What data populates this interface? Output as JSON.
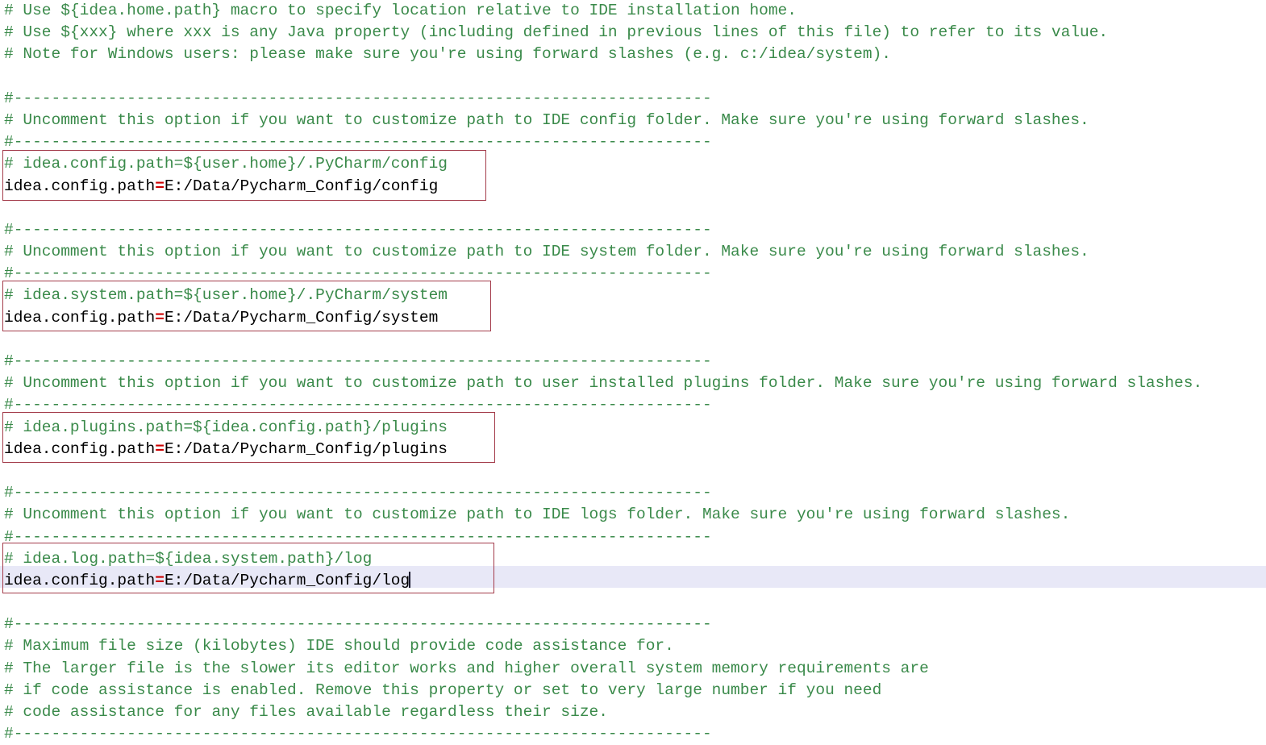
{
  "editor": {
    "kind": "properties-file-editor",
    "colors": {
      "background": "#ffffff",
      "comment": "#3a8a4a",
      "text": "#000000",
      "separator_red": "#cc0000",
      "box_border": "#a33b4a",
      "current_line": "#e8e8f7"
    },
    "separator_line": "#--------------------------------------------------------------------------",
    "caret_symbol": "text-caret"
  },
  "lines": [
    {
      "type": "comment",
      "text": "# Use ${idea.home.path} macro to specify location relative to IDE installation home."
    },
    {
      "type": "comment",
      "text": "# Use ${xxx} where xxx is any Java property (including defined in previous lines of this file) to refer to its value."
    },
    {
      "type": "comment",
      "text": "# Note for Windows users: please make sure you're using forward slashes (e.g. c:/idea/system)."
    },
    {
      "type": "blank",
      "text": ""
    },
    {
      "type": "comment",
      "text": "#--------------------------------------------------------------------------"
    },
    {
      "type": "comment",
      "text": "# Uncomment this option if you want to customize path to IDE config folder. Make sure you're using forward slashes."
    },
    {
      "type": "comment",
      "text": "#--------------------------------------------------------------------------"
    },
    {
      "type": "comment",
      "text": "# idea.config.path=${user.home}/.PyCharm/config"
    },
    {
      "type": "property",
      "key": "idea.config.path",
      "eq": "=",
      "value": "E:/Data/Pycharm_Config/config"
    },
    {
      "type": "blank",
      "text": ""
    },
    {
      "type": "comment",
      "text": "#--------------------------------------------------------------------------"
    },
    {
      "type": "comment",
      "text": "# Uncomment this option if you want to customize path to IDE system folder. Make sure you're using forward slashes."
    },
    {
      "type": "comment",
      "text": "#--------------------------------------------------------------------------"
    },
    {
      "type": "comment",
      "text": "# idea.system.path=${user.home}/.PyCharm/system"
    },
    {
      "type": "property",
      "key": "idea.config.path",
      "eq": "=",
      "value": "E:/Data/Pycharm_Config/system"
    },
    {
      "type": "blank",
      "text": ""
    },
    {
      "type": "comment",
      "text": "#--------------------------------------------------------------------------"
    },
    {
      "type": "comment",
      "text": "# Uncomment this option if you want to customize path to user installed plugins folder. Make sure you're using forward slashes."
    },
    {
      "type": "comment",
      "text": "#--------------------------------------------------------------------------"
    },
    {
      "type": "comment",
      "text": "# idea.plugins.path=${idea.config.path}/plugins"
    },
    {
      "type": "property",
      "key": "idea.config.path",
      "eq": "=",
      "value": "E:/Data/Pycharm_Config/plugins"
    },
    {
      "type": "blank",
      "text": ""
    },
    {
      "type": "comment",
      "text": "#--------------------------------------------------------------------------"
    },
    {
      "type": "comment",
      "text": "# Uncomment this option if you want to customize path to IDE logs folder. Make sure you're using forward slashes."
    },
    {
      "type": "comment",
      "text": "#--------------------------------------------------------------------------"
    },
    {
      "type": "comment",
      "text": "# idea.log.path=${idea.system.path}/log"
    },
    {
      "type": "property",
      "key": "idea.config.path",
      "eq": "=",
      "value": "E:/Data/Pycharm_Config/log",
      "active": true
    },
    {
      "type": "blank",
      "text": ""
    },
    {
      "type": "comment",
      "text": "#--------------------------------------------------------------------------"
    },
    {
      "type": "comment",
      "text": "# Maximum file size (kilobytes) IDE should provide code assistance for."
    },
    {
      "type": "comment",
      "text": "# The larger file is the slower its editor works and higher overall system memory requirements are"
    },
    {
      "type": "comment",
      "text": "# if code assistance is enabled. Remove this property or set to very large number if you need"
    },
    {
      "type": "comment",
      "text": "# code assistance for any files available regardless their size."
    },
    {
      "type": "comment",
      "text": "#--------------------------------------------------------------------------"
    }
  ]
}
